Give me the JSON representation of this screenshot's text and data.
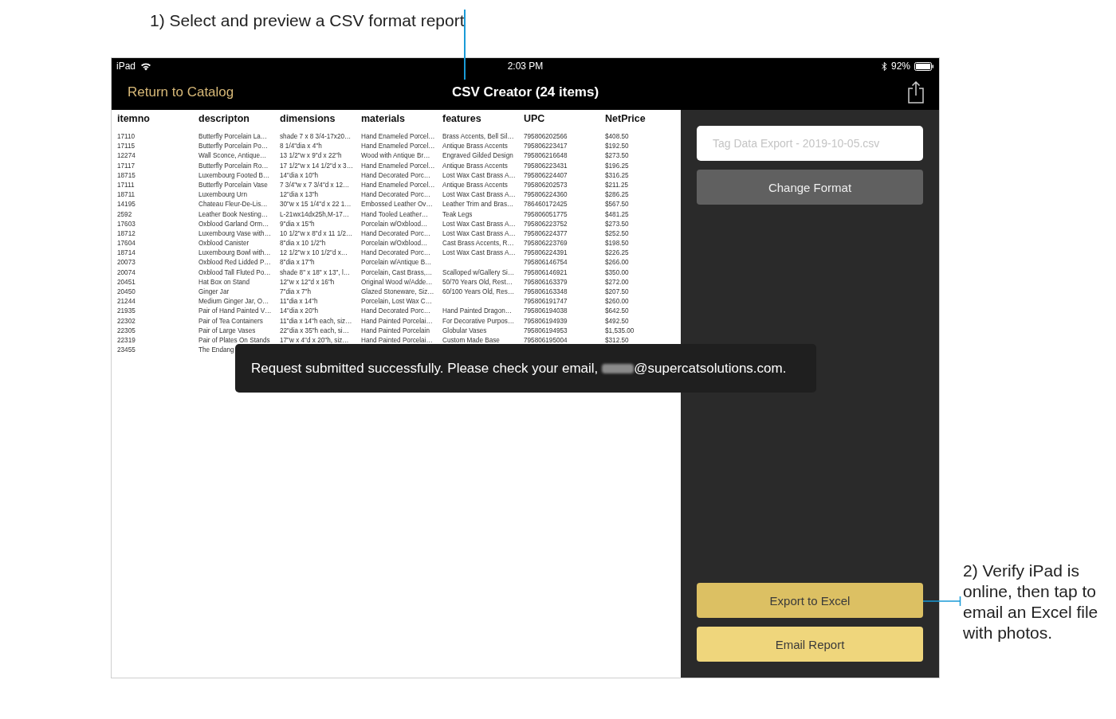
{
  "annotations": [
    {
      "text": "1) Select and preview a CSV format report"
    },
    {
      "text": "2) Verify iPad is online, then tap to email an Excel file with photos."
    }
  ],
  "status_bar": {
    "device": "iPad",
    "time": "2:03 PM",
    "battery": "92%"
  },
  "nav_bar": {
    "back": "Return to Catalog",
    "title": "CSV Creator (24 items)"
  },
  "table": {
    "columns": [
      "itemno",
      "descripton",
      "dimensions",
      "materials",
      "features",
      "UPC",
      "NetPrice"
    ],
    "rows": [
      [
        "17110",
        "Butterfly Porcelain La…",
        "shade 7 x 8 3/4-17x20…",
        "Hand Enameled Porcel…",
        "Brass Accents, Bell Sil…",
        "795806202566",
        "$408.50"
      ],
      [
        "17115",
        "Butterfly Porcelain Po…",
        "8 1/4\"dia x 4\"h",
        "Hand Enameled Porcel…",
        "Antique Brass Accents",
        "795806223417",
        "$192.50"
      ],
      [
        "12274",
        "Wall Sconce, Antique…",
        "13 1/2\"w x 9\"d x 22\"h",
        "Wood with Antique Br…",
        "Engraved Gilded Design",
        "795806216648",
        "$273.50"
      ],
      [
        "17117",
        "Butterfly Porcelain Ro…",
        "17 1/2\"w x 14 1/2\"d x 3…",
        "Hand Enameled Porcel…",
        "Antique Brass Accents",
        "795806223431",
        "$196.25"
      ],
      [
        "18715",
        "Luxembourg Footed B…",
        "14\"dia x 10\"h",
        "Hand Decorated Porc…",
        "Lost Wax Cast Brass A…",
        "795806224407",
        "$316.25"
      ],
      [
        "17111",
        "Butterfly Porcelain Vase",
        "7 3/4\"w x 7 3/4\"d x 12…",
        "Hand Enameled Porcel…",
        "Antique Brass Accents",
        "795806202573",
        "$211.25"
      ],
      [
        "18711",
        "Luxembourg Urn",
        "12\"dia x 13\"h",
        "Hand Decorated Porc…",
        "Lost Wax Cast Brass A…",
        "795806224360",
        "$286.25"
      ],
      [
        "14195",
        "Chateau Fleur-De-Lis…",
        "30\"w x 15 1/4\"d x 22 1…",
        "Embossed Leather Ov…",
        "Leather Trim and Bras…",
        "786460172425",
        "$567.50"
      ],
      [
        "2592",
        "Leather Book Nesting…",
        "L-21wx14dx25h,M-17…",
        "Hand Tooled Leather…",
        "Teak Legs",
        "795806051775",
        "$481.25"
      ],
      [
        "17603",
        "Oxblood Garland Orm…",
        "9\"dia x 15\"h",
        "Porcelain w/Oxblood…",
        "Lost Wax Cast Brass A…",
        "795806223752",
        "$273.50"
      ],
      [
        "18712",
        "Luxembourg Vase with…",
        "10 1/2\"w x 8\"d x 11 1/2…",
        "Hand Decorated Porc…",
        "Lost Wax Cast Brass A…",
        "795806224377",
        "$252.50"
      ],
      [
        "17604",
        "Oxblood Canister",
        "8\"dia x 10 1/2\"h",
        "Porcelain w/Oxblood…",
        "Cast Brass Accents, R…",
        "795806223769",
        "$198.50"
      ],
      [
        "18714",
        "Luxembourg Bowl with…",
        "12 1/2\"w x 10 1/2\"d x…",
        "Hand Decorated Porc…",
        "Lost Wax Cast Brass A…",
        "795806224391",
        "$226.25"
      ],
      [
        "20073",
        "Oxblood Red Lidded P…",
        "8\"dia x 17\"h",
        "Porcelain w/Antique B…",
        null,
        "795806146754",
        "$266.00"
      ],
      [
        "20074",
        "Oxblood Tall Fluted Po…",
        "shade 8\" x 18\" x 13\", l…",
        "Porcelain, Cast Brass,…",
        "Scalloped w/Gallery Si…",
        "795806146921",
        "$350.00"
      ],
      [
        "20451",
        "Hat Box on Stand",
        "12\"w x 12\"d x 16\"h",
        "Original Wood w/Adde…",
        "50/70 Years Old, Rest…",
        "795806163379",
        "$272.00"
      ],
      [
        "20450",
        "Ginger Jar",
        "7\"dia x 7\"h",
        "Glazed Stoneware, Siz…",
        "60/100 Years Old, Res…",
        "795806163348",
        "$207.50"
      ],
      [
        "21244",
        "Medium Ginger Jar, O…",
        "11\"dia x 14\"h",
        "Porcelain, Lost Wax C…",
        null,
        "795806191747",
        "$260.00"
      ],
      [
        "21935",
        "Pair of Hand Painted V…",
        "14\"dia x 20\"h",
        "Hand Decorated Porc…",
        "Hand Painted Dragon…",
        "795806194038",
        "$642.50"
      ],
      [
        "22302",
        "Pair of Tea Containers",
        "11\"dia x 14\"h each, siz…",
        "Hand Painted Porcelai…",
        "For Decorative Purpos…",
        "795806194939",
        "$492.50"
      ],
      [
        "22305",
        "Pair of Large Vases",
        "22\"dia x 35\"h each, si…",
        "Hand Painted Porcelain",
        "Globular Vases",
        "795806194953",
        "$1,535.00"
      ],
      [
        "22319",
        "Pair of Plates On Stands",
        "17\"w x 4\"d x 20\"h, siz…",
        "Hand Painted Porcelai…",
        "Custom Made Base",
        "795806195004",
        "$312.50"
      ],
      [
        "23455",
        "The Endang",
        null,
        null,
        null,
        null,
        null
      ]
    ]
  },
  "toast": {
    "before": "Request submitted successfully. Please check your email,",
    "after": "@supercatsolutions.com."
  },
  "file_name": {
    "placeholder": "Tag Data Export - 2019-10-05.csv"
  },
  "buttons": [
    {
      "label": "Change Format",
      "kind": "secondary"
    },
    {
      "label": "Export to Excel",
      "kind": "primary"
    },
    {
      "label": "Email Report",
      "kind": "accent"
    }
  ]
}
